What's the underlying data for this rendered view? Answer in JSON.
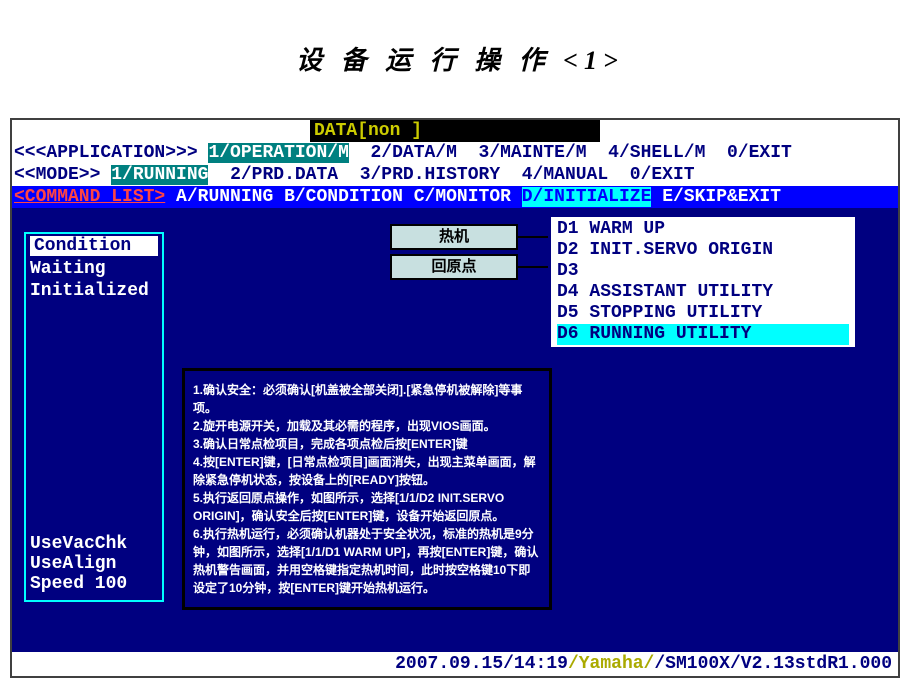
{
  "slide_title": "设 备 运 行 操 作 <1>",
  "data_chip": "DATA[non                     ]",
  "app_row": {
    "label": "<<<APPLICATION>>>",
    "items": [
      "1/OPERATION/M",
      "2/DATA/M",
      "3/MAINTE/M",
      "4/SHELL/M",
      "0/EXIT"
    ],
    "selected": 0
  },
  "mode_row": {
    "label": "<<MODE>>",
    "items": [
      "1/RUNNING",
      "2/PRD.DATA",
      "3/PRD.HISTORY",
      "4/MANUAL",
      "0/EXIT"
    ],
    "selected": 0
  },
  "cmd_row": {
    "label": "<COMMAND LIST>",
    "items": [
      "A/RUNNING",
      "B/CONDITION",
      "C/MONITOR",
      "D/INITIALIZE",
      "E/SKIP&EXIT"
    ],
    "selected": 3
  },
  "sidebar": {
    "header": "Condition",
    "lines": [
      "Waiting",
      "Initialized"
    ],
    "bottom": [
      "UseVacChk",
      "UseAlign",
      "Speed 100"
    ]
  },
  "popup": {
    "items": [
      {
        "code": "D1",
        "label": "WARM UP"
      },
      {
        "code": "D2",
        "label": "INIT.SERVO ORIGIN"
      },
      {
        "code": "D3",
        "label": ""
      },
      {
        "code": "D4",
        "label": "ASSISTANT UTILITY"
      },
      {
        "code": "D5",
        "label": "STOPPING UTILITY"
      },
      {
        "code": "D6",
        "label": "RUNNING UTILITY"
      }
    ],
    "highlighted": 5
  },
  "cn_buttons": {
    "warmup": "热机",
    "origin": "回原点"
  },
  "instructions": [
    "1.确认安全：必须确认[机盖被全部关闭].[紧急停机被解除]等事项。",
    "2.旋开电源开关，加载及其必需的程序，出现VIOS画面。",
    "3.确认日常点检项目，完成各项点检后按[ENTER]键",
    "4.按[ENTER]键，[日常点检项目]画面消失，出现主菜单画面，解除紧急停机状态，按设备上的[READY]按钮。",
    "5.执行返回原点操作，如图所示，选择[1/1/D2 INIT.SERVO ORIGIN]，确认安全后按[ENTER]键，设备开始返回原点。",
    "6.执行热机运行，必须确认机器处于安全状况，标准的热机是9分钟，如图所示，选择[1/1/D1 WARM UP]，再按[ENTER]键，确认热机警告画面，并用空格键指定热机时间，此时按空格键10下即设定了10分钟，按[ENTER]键开始热机运行。"
  ],
  "statusbar": {
    "datetime": "2007.09.15/14:19",
    "vendor": "/Yamaha/",
    "model": "/SM100X/V2.13stdR1.000"
  }
}
